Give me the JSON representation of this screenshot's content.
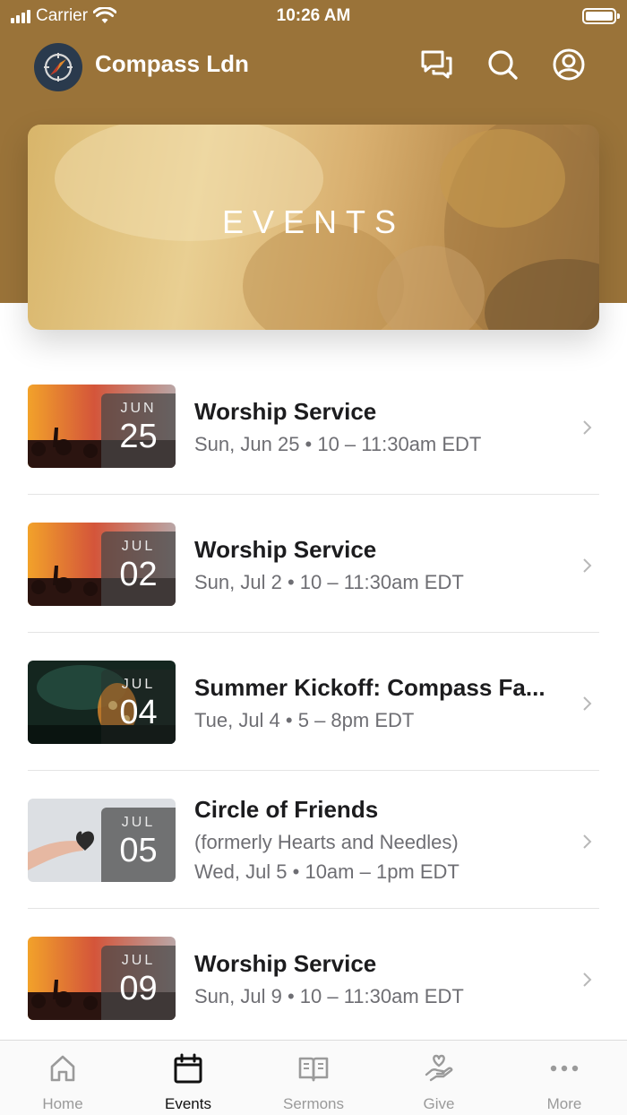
{
  "status_bar": {
    "carrier": "Carrier",
    "time": "10:26 AM"
  },
  "header": {
    "app_name": "Compass Ldn",
    "icons": [
      "chat-icon",
      "search-icon",
      "profile-icon"
    ]
  },
  "hero": {
    "title": "EVENTS"
  },
  "events": [
    {
      "month": "JUN",
      "day": "25",
      "title": "Worship Service",
      "line1": "Sun, Jun 25 • 10 – 11:30am EDT",
      "line2": "",
      "thumb": "concert"
    },
    {
      "month": "JUL",
      "day": "02",
      "title": "Worship Service",
      "line1": "Sun, Jul 2 • 10 – 11:30am EDT",
      "line2": "",
      "thumb": "concert"
    },
    {
      "month": "JUL",
      "day": "04",
      "title": "Summer Kickoff: Compass Fa...",
      "line1": "Tue, Jul 4 • 5 – 8pm EDT",
      "line2": "",
      "thumb": "fireworks"
    },
    {
      "month": "JUL",
      "day": "05",
      "title": "Circle of Friends",
      "line1": "(formerly Hearts and Needles)",
      "line2": "Wed, Jul 5 • 10am – 1pm EDT",
      "thumb": "heart"
    },
    {
      "month": "JUL",
      "day": "09",
      "title": "Worship Service",
      "line1": "Sun, Jul 9 • 10 – 11:30am EDT",
      "line2": "",
      "thumb": "concert"
    }
  ],
  "tabs": [
    {
      "label": "Home",
      "icon": "home-icon",
      "active": false
    },
    {
      "label": "Events",
      "icon": "calendar-icon",
      "active": true
    },
    {
      "label": "Sermons",
      "icon": "book-icon",
      "active": false
    },
    {
      "label": "Give",
      "icon": "give-icon",
      "active": false
    },
    {
      "label": "More",
      "icon": "more-icon",
      "active": false
    }
  ],
  "colors": {
    "header_bg": "#9a7339",
    "active_tab": "#111111",
    "inactive_tab": "#9a9a9a"
  }
}
